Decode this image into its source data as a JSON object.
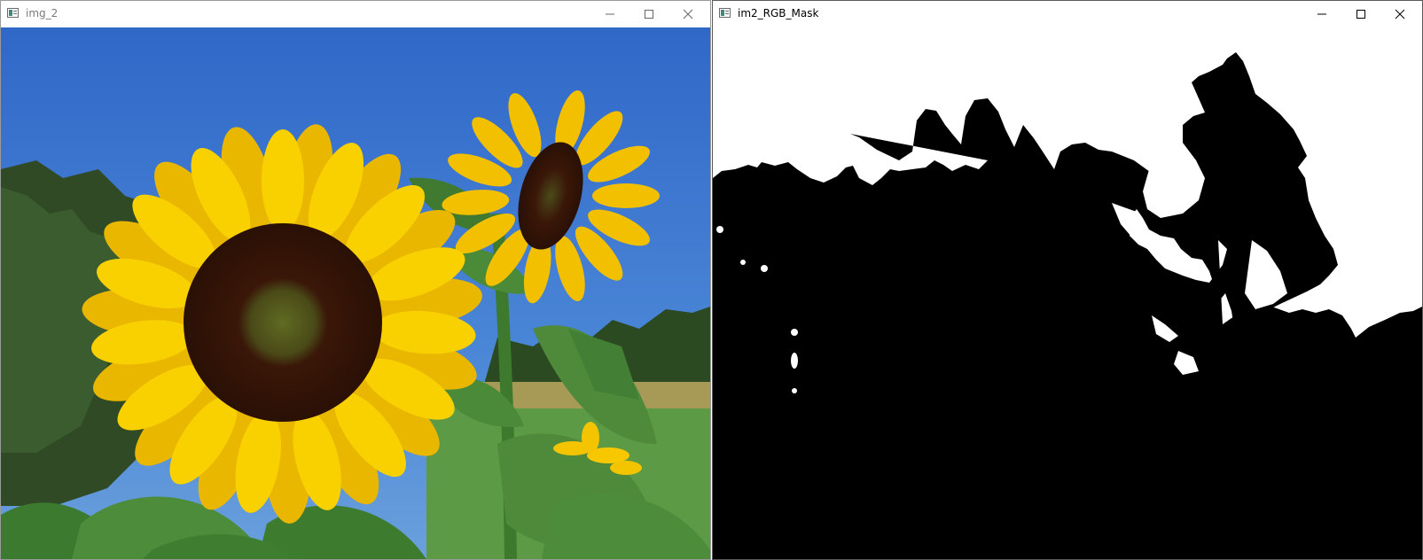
{
  "windows": [
    {
      "title": "img_2",
      "icon": "opencv-window-icon",
      "controls": [
        "minimize-icon",
        "maximize-icon",
        "close-icon"
      ],
      "content": "sunflower-photo"
    },
    {
      "title": "im2_RGB_Mask",
      "icon": "opencv-window-icon",
      "controls": [
        "minimize-icon",
        "maximize-icon",
        "close-icon"
      ],
      "content": "binary-mask-image"
    }
  ],
  "colors": {
    "sky": "#3f7fd4",
    "petal": "#f5c400",
    "center": "#3d1a08",
    "leaf": "#3e7a2e",
    "mask_black": "#000000",
    "mask_white": "#ffffff"
  }
}
